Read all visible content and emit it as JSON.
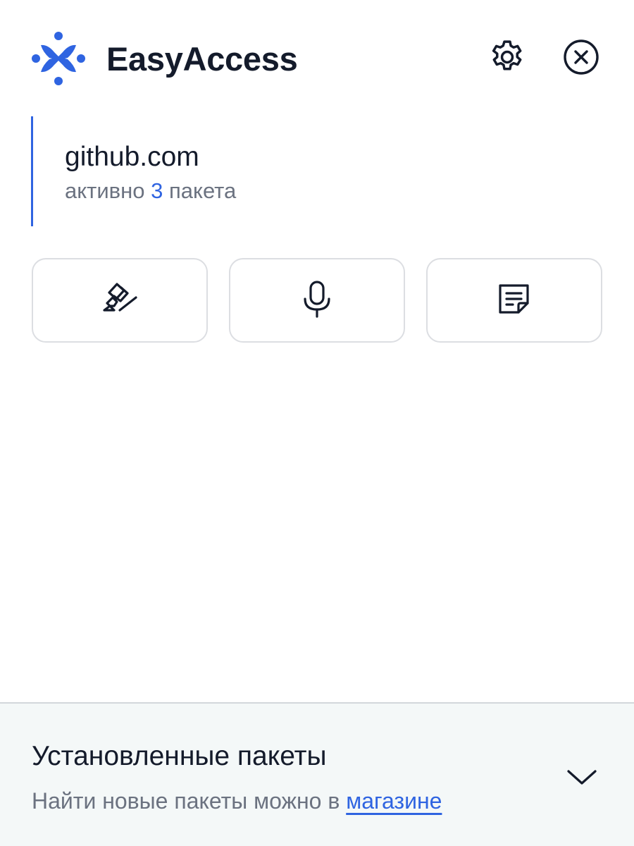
{
  "app": {
    "title": "EasyAccess",
    "logo_icon": "easyaccess-logo-icon",
    "accent_color": "#2f64e1"
  },
  "header": {
    "settings_icon": "gear-icon",
    "close_icon": "close-circle-icon"
  },
  "site": {
    "domain": "github.com",
    "status_prefix": "активно",
    "active_count": "3",
    "status_suffix": "пакета"
  },
  "tools": [
    {
      "icon": "highlighter-icon"
    },
    {
      "icon": "microphone-icon"
    },
    {
      "icon": "note-icon"
    }
  ],
  "footer": {
    "title": "Установленные пакеты",
    "subtitle_prefix": "Найти новые пакеты можно в",
    "store_link": "магазине",
    "chevron_icon": "chevron-down-icon"
  }
}
